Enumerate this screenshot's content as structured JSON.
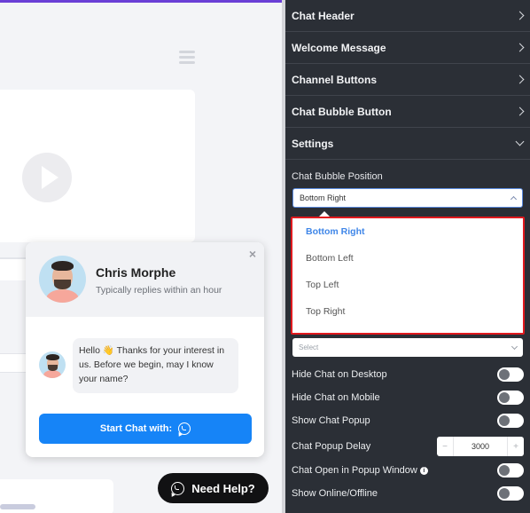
{
  "preview": {
    "popup": {
      "name": "Chris Morphe",
      "subtitle": "Typically replies within an hour",
      "message": "Hello 👋 Thanks for your interest in us. Before we begin, may I know your name?",
      "start_button": "Start Chat with:",
      "close_glyph": "×"
    },
    "need_help": "Need Help?"
  },
  "panel": {
    "sections": [
      {
        "label": "Chat Header",
        "icon": "chevron-right-icon"
      },
      {
        "label": "Welcome Message",
        "icon": "chevron-right-icon"
      },
      {
        "label": "Channel Buttons",
        "icon": "chevron-right-icon"
      },
      {
        "label": "Chat Bubble Button",
        "icon": "chevron-right-icon"
      },
      {
        "label": "Settings",
        "icon": "chevron-down-icon"
      }
    ],
    "position_label": "Chat Bubble Position",
    "position_value": "Bottom Right",
    "position_options": [
      "Bottom Right",
      "Bottom Left",
      "Top Left",
      "Top Right"
    ],
    "second_select_placeholder": "Select",
    "toggles": {
      "hide_desktop": "Hide Chat on Desktop",
      "hide_mobile": "Hide Chat on Mobile",
      "show_popup": "Show Chat Popup",
      "popup_delay": "Chat Popup Delay",
      "open_popup_window": "Chat Open in Popup Window",
      "show_online": "Show Online/Offline"
    },
    "delay": {
      "minus": "−",
      "value": "3000",
      "plus": "+"
    },
    "info_glyph": "i"
  },
  "colors": {
    "panel_bg": "#2b2f36",
    "accent_blue": "#1684f7",
    "highlight_red": "#e0191e",
    "selected_option": "#3f86e8"
  }
}
